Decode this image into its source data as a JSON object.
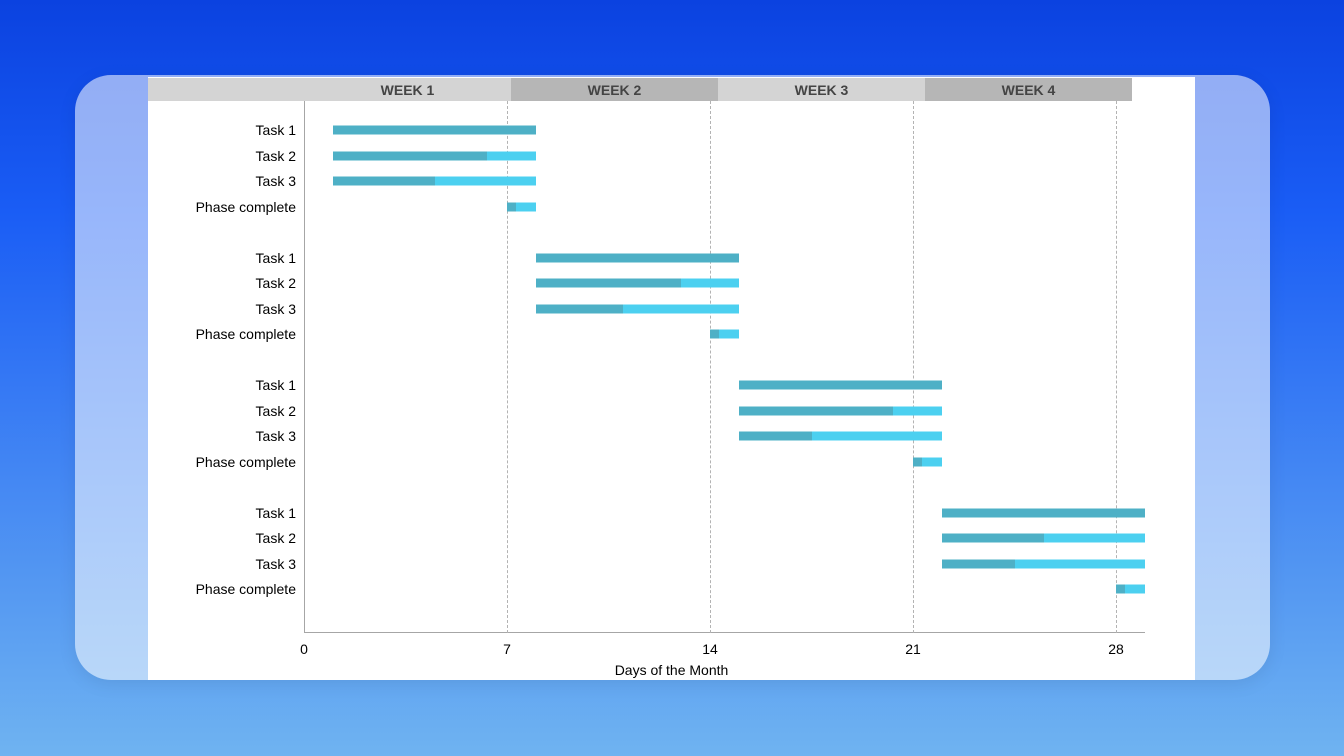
{
  "chart_data": {
    "type": "bar",
    "orientation": "horizontal",
    "xlabel": "Days of the Month",
    "xlim": [
      0,
      29
    ],
    "xticks": [
      0,
      7,
      14,
      21,
      28
    ],
    "week_headers": [
      "WEEK 1",
      "WEEK 2",
      "WEEK 3",
      "WEEK 4"
    ],
    "colors": {
      "completed": "#4eb0c6",
      "remaining": "#4cd0f0"
    },
    "phases": [
      {
        "tasks": [
          {
            "label": "Task 1",
            "start": 1,
            "end": 8,
            "completed_end": 8
          },
          {
            "label": "Task 2",
            "start": 1,
            "end": 8,
            "completed_end": 6.3
          },
          {
            "label": "Task 3",
            "start": 1,
            "end": 8,
            "completed_end": 4.5
          },
          {
            "label": "Phase complete",
            "start": 7,
            "end": 8,
            "completed_end": 7.3
          }
        ]
      },
      {
        "tasks": [
          {
            "label": "Task 1",
            "start": 8,
            "end": 15,
            "completed_end": 15
          },
          {
            "label": "Task 2",
            "start": 8,
            "end": 15,
            "completed_end": 13
          },
          {
            "label": "Task 3",
            "start": 8,
            "end": 15,
            "completed_end": 11
          },
          {
            "label": "Phase complete",
            "start": 14,
            "end": 15,
            "completed_end": 14.3
          }
        ]
      },
      {
        "tasks": [
          {
            "label": "Task 1",
            "start": 15,
            "end": 22,
            "completed_end": 22
          },
          {
            "label": "Task 2",
            "start": 15,
            "end": 22,
            "completed_end": 20.3
          },
          {
            "label": "Task 3",
            "start": 15,
            "end": 22,
            "completed_end": 17.5
          },
          {
            "label": "Phase complete",
            "start": 21,
            "end": 22,
            "completed_end": 21.3
          }
        ]
      },
      {
        "tasks": [
          {
            "label": "Task 1",
            "start": 22,
            "end": 29,
            "completed_end": 29
          },
          {
            "label": "Task 2",
            "start": 22,
            "end": 29,
            "completed_end": 25.5
          },
          {
            "label": "Task 3",
            "start": 22,
            "end": 29,
            "completed_end": 24.5
          },
          {
            "label": "Phase complete",
            "start": 28,
            "end": 29,
            "completed_end": 28.3
          }
        ]
      }
    ]
  }
}
